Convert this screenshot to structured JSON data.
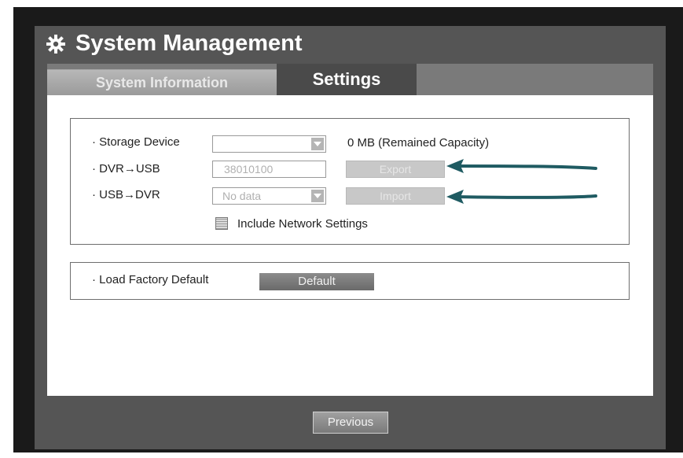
{
  "window": {
    "title": "System Management",
    "title_icon": "gear-icon"
  },
  "tabs": [
    {
      "label": "System Information",
      "active": false
    },
    {
      "label": "Settings",
      "active": true
    }
  ],
  "backup": {
    "storage_device": {
      "label": "· Storage Device",
      "value": "",
      "capacity": "0 MB (Remained Capacity)"
    },
    "dvr_to_usb": {
      "label": "· DVR→USB",
      "value": "38010100",
      "button": "Export"
    },
    "usb_to_dvr": {
      "label": "· USB→DVR",
      "value": "No data",
      "button": "Import"
    },
    "include_network": {
      "label": "Include Network Settings",
      "checked": false
    }
  },
  "factory": {
    "label": "· Load Factory Default",
    "button": "Default"
  },
  "footer": {
    "previous": "Previous"
  },
  "colors": {
    "annotation_arrow": "#1f5b62",
    "frame": "#1a1a1a",
    "window": "#555555"
  }
}
